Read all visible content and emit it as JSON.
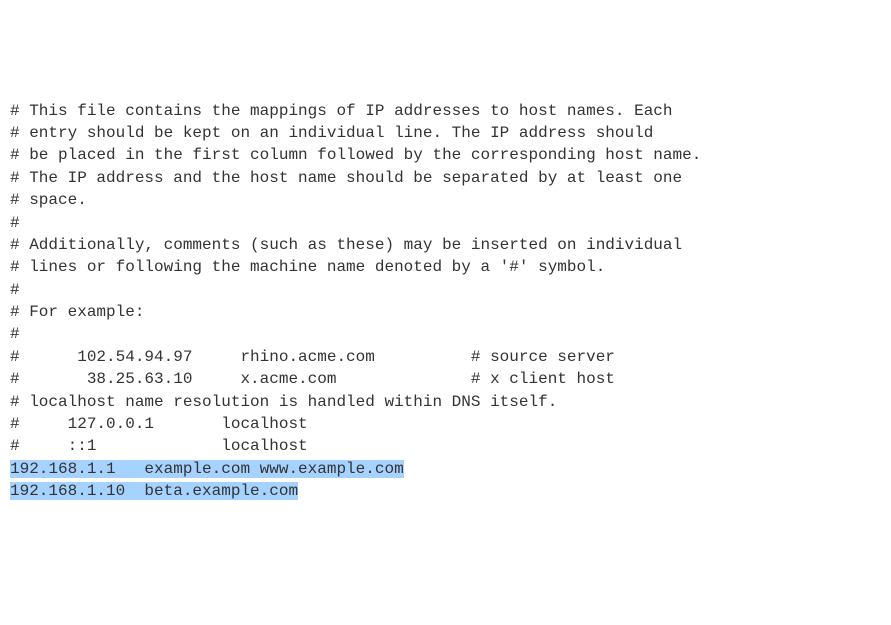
{
  "lines": {
    "l1": "# This file contains the mappings of IP addresses to host names. Each",
    "l2": "# entry should be kept on an individual line. The IP address should",
    "l3": "# be placed in the first column followed by the corresponding host name.",
    "l4": "# The IP address and the host name should be separated by at least one",
    "l5": "# space.",
    "l6": "#",
    "l7": "# Additionally, comments (such as these) may be inserted on individual",
    "l8": "# lines or following the machine name denoted by a '#' symbol.",
    "l9": "#",
    "l10": "# For example:",
    "l11": "#",
    "l12": "#      102.54.94.97     rhino.acme.com          # source server",
    "l13": "#       38.25.63.10     x.acme.com              # x client host",
    "l14": "",
    "l15": "# localhost name resolution is handled within DNS itself.",
    "l16": "#     127.0.0.1       localhost",
    "l17": "#     ::1             localhost",
    "l18": "",
    "l19": "192.168.1.1   example.com www.example.com",
    "l20": "192.168.1.10  beta.example.com"
  }
}
